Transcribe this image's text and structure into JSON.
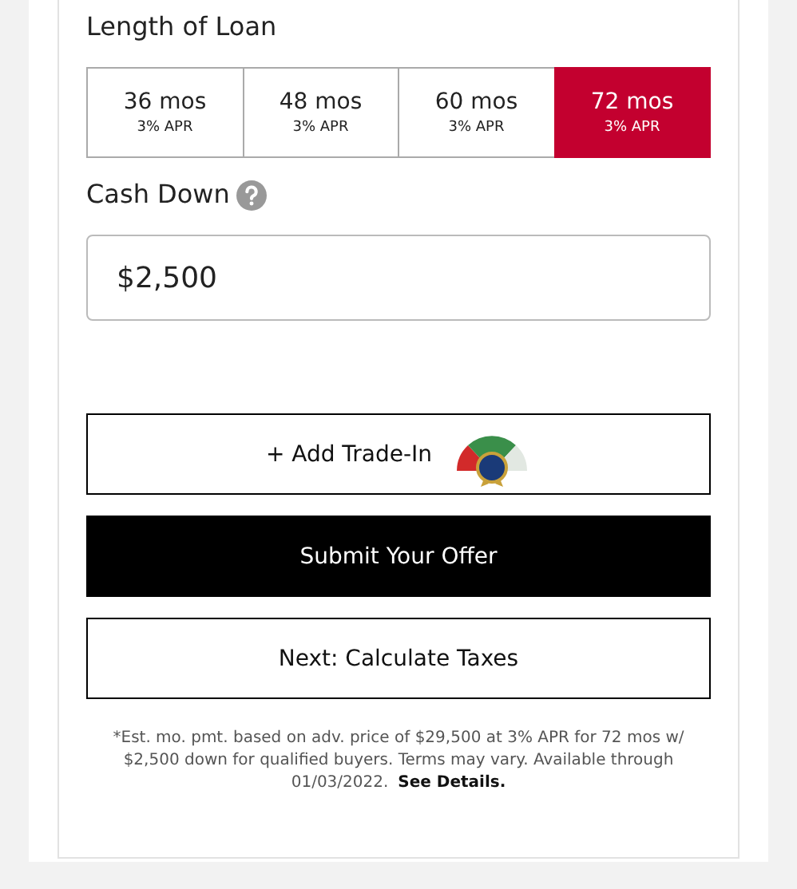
{
  "loan_length": {
    "label": "Length of Loan",
    "options": [
      {
        "term": "36 mos",
        "rate": "3% APR",
        "selected": false
      },
      {
        "term": "48 mos",
        "rate": "3% APR",
        "selected": false
      },
      {
        "term": "60 mos",
        "rate": "3% APR",
        "selected": false
      },
      {
        "term": "72 mos",
        "rate": "3% APR",
        "selected": true
      }
    ]
  },
  "cash_down": {
    "label": "Cash Down",
    "value": "$2,500"
  },
  "buttons": [
    {
      "kind": "trade",
      "label": "+ Add Trade-In"
    },
    {
      "kind": "primary",
      "label": "Submit Your Offer"
    },
    {
      "kind": "secondary",
      "label": "Next: Calculate Taxes"
    }
  ],
  "disclaimer": {
    "text": "*Est. mo. pmt. based on adv. price of $29,500 at 3% APR for 72 mos w/ $2,500 down for qualified buyers. Terms may vary. Available through 01/03/2022.",
    "link": "See Details."
  }
}
